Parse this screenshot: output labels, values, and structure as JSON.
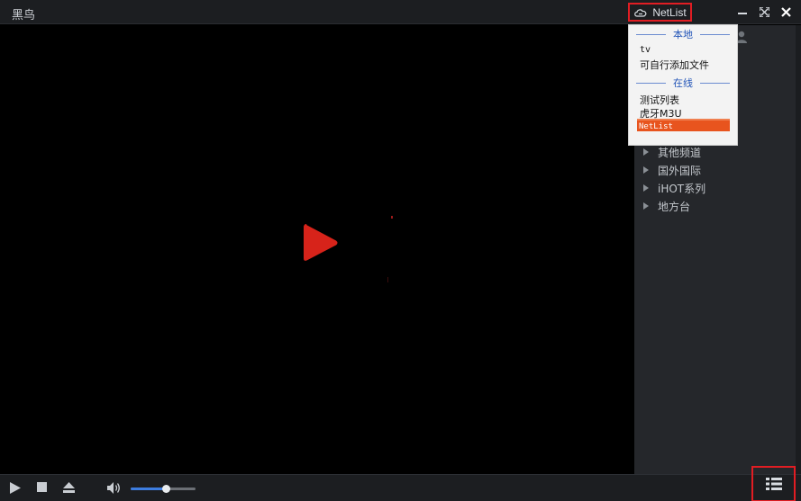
{
  "window": {
    "title": "黑鸟",
    "netlist_label": "NetList",
    "colors": {
      "accent": "#e8541e",
      "highlight_box": "#e11d23",
      "header_blue": "#2456b8"
    }
  },
  "video": {
    "play_icon": "play-triangle-icon",
    "play_color": "#d7231a"
  },
  "dropdown": {
    "local_header": "本地",
    "local_items": [
      "tv",
      "可自行添加文件"
    ],
    "online_header": "在线",
    "online_items": [
      "测试列表",
      "虎牙M3U",
      "NetList"
    ],
    "active_item": "NetList"
  },
  "sidebar": {
    "categories": [
      "其他频道",
      "国外国际",
      "iHOT系列",
      "地方台"
    ]
  },
  "controls": {
    "volume_level": 0.55,
    "icons": [
      "play-icon",
      "stop-icon",
      "eject-icon",
      "volume-icon",
      "playlist-icon"
    ]
  }
}
